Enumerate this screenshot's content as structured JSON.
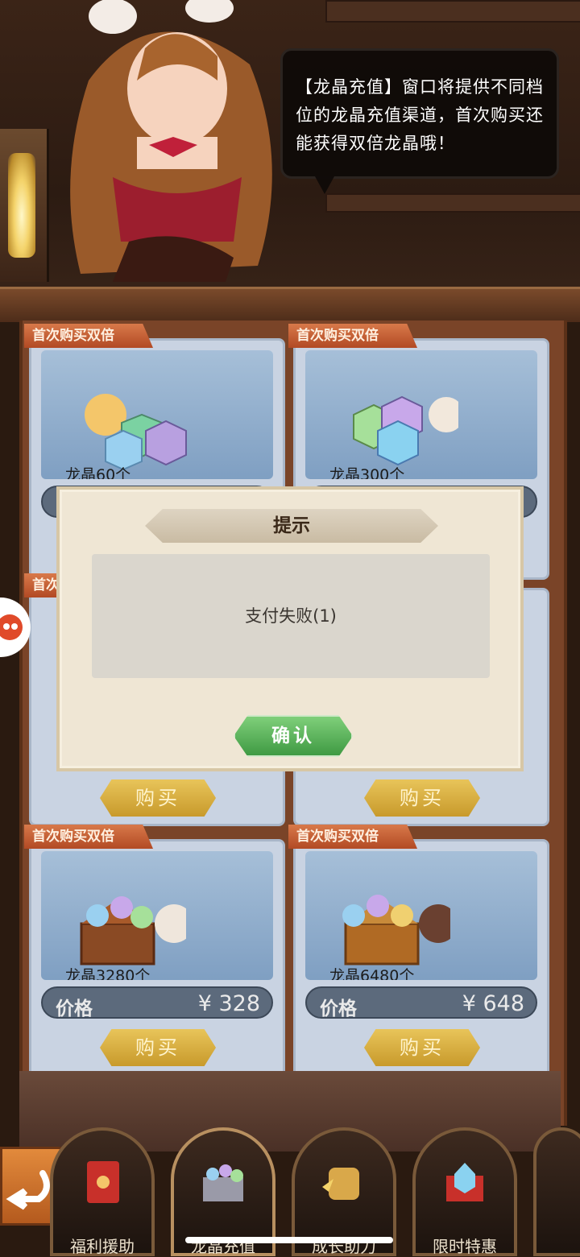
{
  "speech_text": "【龙晶充值】窗口将提供不同档位的龙晶充值渠道，首次购买还能获得双倍龙晶哦！",
  "ribbon_label": "首次购买双倍",
  "cards": [
    {
      "quantity": "龙晶60个"
    },
    {
      "quantity": "龙晶300个"
    },
    {
      "quantity": "龙晶3280个",
      "price_label": "价格",
      "price_value": "¥ 328"
    },
    {
      "quantity": "龙晶6480个",
      "price_label": "价格",
      "price_value": "¥ 648"
    }
  ],
  "buy_label": "购买",
  "dialog": {
    "title": "提示",
    "message": "支付失败(1)",
    "confirm_label": "确认"
  },
  "tabs": [
    {
      "label": "福利援助",
      "icon": "red-envelope-icon"
    },
    {
      "label": "龙晶充值",
      "icon": "treasure-chest-icon"
    },
    {
      "label": "成长助力",
      "icon": "fist-icon"
    },
    {
      "label": "限时特惠",
      "icon": "gift-box-icon"
    }
  ],
  "colors": {
    "confirm_green": "#4fae4f",
    "buy_gold": "#d8b044",
    "ribbon_orange": "#c45a2e"
  }
}
